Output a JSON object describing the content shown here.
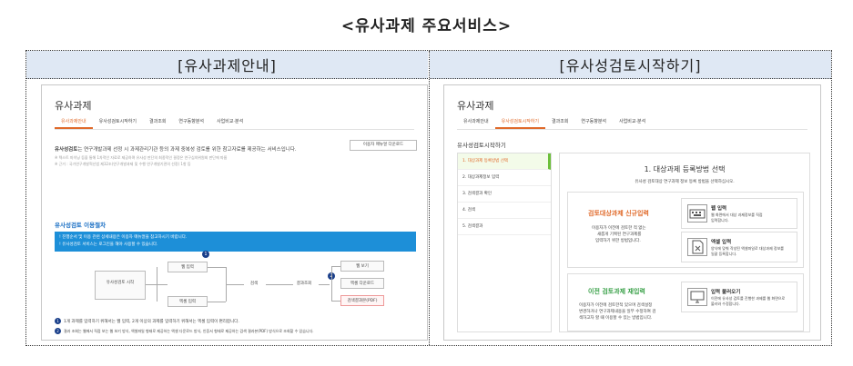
{
  "document_title": "<유사과제 주요서비스>",
  "panels": {
    "left_header": "[유사과제안내]",
    "right_header": "[유사성검토시작하기]"
  },
  "left_shot": {
    "title": "유사과제",
    "tabs": [
      "유사과제안내",
      "유사성검토시작하기",
      "결과조회",
      "연구동향분석",
      "사업비교·분석"
    ],
    "manual_button": "이용자 매뉴얼 다운로드",
    "intro_label": "유사성검토",
    "intro_text": "는 연구개발과제 선정 시 과제관리기관 등의 과제 중복성 검토를 위한 참고자료를 제공하는 서비스입니다.",
    "bullet1": "※ 텍스트 마이닝 등을 통해 1차적인 자료로 제공하며 유사성 판단의 최종적인 결정은 연구심의위원회 판단에 따름",
    "bullet2": "※ 근거 : 국가연구개발혁신법 제32조(연구개발과제 및 수행 연구개발기관의 선정) 1항 등",
    "procedure_title": "유사성검토 이용절차",
    "notice_line1": "! 진행순서 및 이용 관련 상세내용은 이용자 매뉴얼을 참고하시기 바랍니다.",
    "notice_line2": "! 유사성검토 서비스는 로그인을 해야 사용할 수 있습니다.",
    "flow_start": "유사성검토 시작",
    "flow_web_input": "웹 입력",
    "flow_excel_input": "엑셀 입력",
    "flow_search": "검색",
    "flow_result": "결과조회",
    "flow_web_view": "웹 보기",
    "flow_excel_download": "엑셀 다운로드",
    "flow_pdf": "검색결과본(PDF)",
    "step1": "1",
    "step2": "2",
    "note1": "1개 과제를 입력하기 위해서는 웹 입력, 2개 이상의 과제를 입력하기 위해서는 엑셀 입력이 편리합니다.",
    "note2": "결과 조회는 웹에서 직접 보는 웹 보기 방식, 엑셀파일 형태로 제공하는 엑셀 다운로드 방식, 인증서 형태로 제공하는 검색 결과본(PDF) 방식으로 조회할 수 있습니다."
  },
  "right_shot": {
    "title": "유사과제",
    "tabs": [
      "유사과제안내",
      "유사성검토시작하기",
      "결과조회",
      "연구동향분석",
      "사업비교·분석"
    ],
    "section_title": "유사성검토시작하기",
    "side_items": [
      "1. 대상과제 등록방법 선택",
      "2. 대상과제정보 입력",
      "3. 검색결과 확인",
      "4. 검색",
      "5. 검색결과"
    ],
    "panel_heading": "1. 대상과제 등록방법 선택",
    "panel_sub": "유사성 검토대상 연구과제 정보 등록 방법을 선택하십시오.",
    "new_title": "검토대상과제 신규입력",
    "new_desc1": "이용자가 이전에 검토한 적 없는",
    "new_desc2": "새롭게 기획된 연구과제를",
    "new_desc3": "입력하기 위한 방법입니다.",
    "web_input_title": "웹 입력",
    "web_input_desc1": "웹 화면에서 대상 과제정보를 직접",
    "web_input_desc2": "입력합니다.",
    "excel_input_title": "엑셀 입력",
    "excel_input_desc1": "양식에 맞춰 작성된 엑셀파일로 대상과제 정보를",
    "excel_input_desc2": "일괄 등록합니다.",
    "prev_title": "이전 검토과제 재입력",
    "prev_desc1": "이용자가 이전에 검토한적 있으며 검색설정",
    "prev_desc2": "변경하거나 연구과제내용을 일부 수정하여 검",
    "prev_desc3": "색하고자 할 때 이용할 수 있는 방법입니다.",
    "load_title": "입력 불러오기",
    "load_desc1": "이전에 유사성 검토를 진행한 과제를 웹 화면으로",
    "load_desc2": "불러와 수정합니다."
  },
  "colors": {
    "header_bg": "#dfe8f4",
    "accent_orange": "#e06a2a",
    "accent_blue": "#1d8fd8",
    "accent_green": "#3ba14a"
  }
}
